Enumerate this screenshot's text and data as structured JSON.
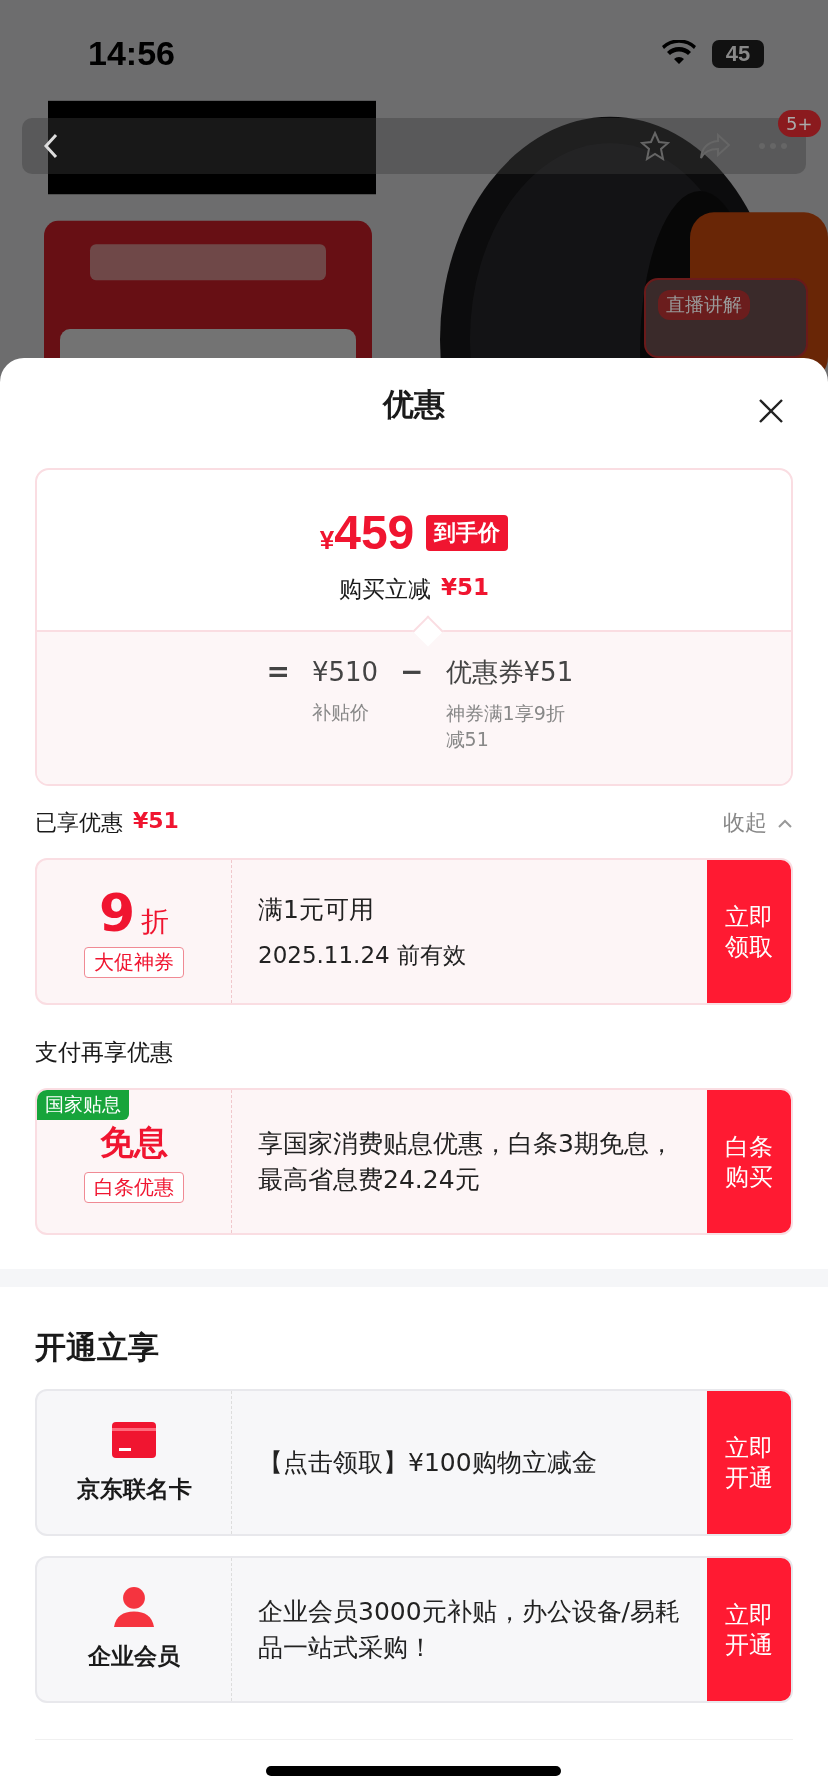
{
  "status_bar": {
    "time": "14:56",
    "battery": "45"
  },
  "nav": {
    "badge": "5+"
  },
  "live": {
    "label": "直播讲解"
  },
  "sheet": {
    "title": "优惠"
  },
  "price_card": {
    "currency": "¥",
    "amount": "459",
    "tag": "到手价",
    "saving_label": "购买立减",
    "saving_amount": "¥51",
    "formula": {
      "equals": "=",
      "base_price": "¥510",
      "minus": "−",
      "coupon": "优惠券¥51",
      "base_label": "补贴价",
      "coupon_label": "神券满1享9折减51"
    }
  },
  "enjoyed": {
    "label": "已享优惠",
    "amount": "¥51",
    "toggle": "收起",
    "expanded": true
  },
  "coupon": {
    "kind": "discount",
    "value": "9",
    "unit": "折",
    "tag": "大促神券",
    "title": "满1元可用",
    "subtitle": "2025.11.24 前有效",
    "action": "立即领取"
  },
  "pay_section": {
    "title": "支付再享优惠"
  },
  "pay_offer": {
    "kind": "interest",
    "corner_tag": "国家贴息",
    "title": "免息",
    "tag": "白条优惠",
    "text": "享国家消费贴息优惠，白条3期免息，最高省息费24.24元",
    "action": "白条购买"
  },
  "membership": {
    "title": "开通立享",
    "items": [
      {
        "kind": "card",
        "name": "京东联名卡",
        "text": "【点击领取】¥100购物立减金",
        "action": "立即开通"
      },
      {
        "kind": "person",
        "name": "企业会员",
        "text": "企业会员3000元补贴，办公设备/易耗品一站式采购！",
        "action": "立即开通"
      }
    ]
  }
}
